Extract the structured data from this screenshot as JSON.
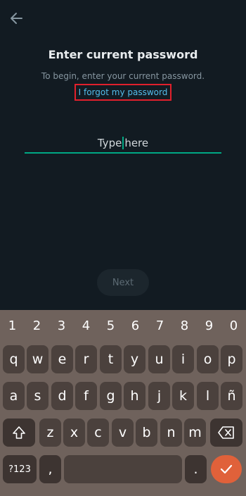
{
  "screen": {
    "title": "Enter current password",
    "subtitle": "To begin, enter your current password.",
    "forgot_link": "I forgot my password",
    "input_before_caret": "Type",
    "input_after_caret": "here",
    "next_label": "Next"
  },
  "keyboard": {
    "number_row": [
      "1",
      "2",
      "3",
      "4",
      "5",
      "6",
      "7",
      "8",
      "9",
      "0"
    ],
    "row1": [
      "q",
      "w",
      "e",
      "r",
      "t",
      "y",
      "u",
      "i",
      "o",
      "p"
    ],
    "row2": [
      "a",
      "s",
      "d",
      "f",
      "g",
      "h",
      "j",
      "k",
      "l",
      "ñ"
    ],
    "row3": [
      "z",
      "x",
      "c",
      "v",
      "b",
      "n",
      "m"
    ],
    "symbols_label": "?123",
    "comma": ",",
    "period": "."
  }
}
